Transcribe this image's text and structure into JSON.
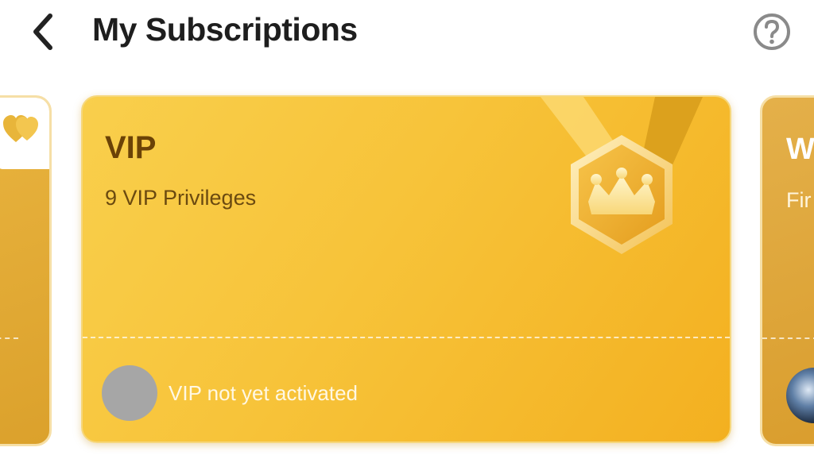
{
  "header": {
    "back_icon": "chevron-left-icon",
    "title": "My Subscriptions",
    "help_icon": "question-circle-icon"
  },
  "cards": {
    "main": {
      "title": "VIP",
      "subtitle": "9 VIP Privileges",
      "status": "VIP not yet activated",
      "badge_icon": "crown-medal-icon",
      "colors": {
        "bg_start": "#f9cf4c",
        "bg_end": "#f3b020",
        "title": "#6b4206"
      }
    },
    "right_peek": {
      "title": "W",
      "subtitle": "Fir"
    },
    "left_peek": {
      "icon": "hearts-icon"
    }
  }
}
